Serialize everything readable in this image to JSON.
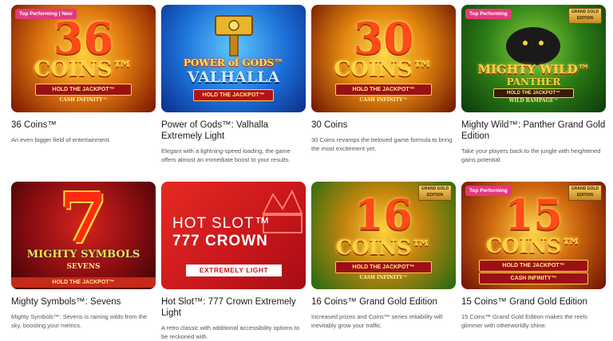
{
  "games": [
    {
      "title": "36 Coins™",
      "desc": "An even bigger field of entertainment.",
      "badge": "Top Performing | New",
      "art_main": "36",
      "art_sub": "COINS™",
      "art_plate": "HOLD THE JACKPOT™",
      "art_plate2": "CASH INFINITY™"
    },
    {
      "title": "Power of Gods™: Valhalla Extremely Light",
      "desc": "Elegant with a lightning-speed loading, the game offers almost an immediate boost to your results.",
      "art_main": "POWER of GODS™",
      "art_sub": "VALHALLA",
      "art_plate": "HOLD THE JACKPOT™"
    },
    {
      "title": "30 Coins",
      "desc": "30 Coins revamps the beloved game formula to bring the most excitement yet.",
      "art_main": "30",
      "art_sub": "COINS™",
      "art_plate": "HOLD THE JACKPOT™",
      "art_plate2": "CASH INFINITY™"
    },
    {
      "title": "Mighty Wild™: Panther Grand Gold Edition",
      "desc": "Take your players back to the jungle with heightened gains potential.",
      "badge": "Top Performing",
      "gold_label": "GRAND GOLD EDITION",
      "art_main": "MIGHTY WILD™",
      "art_sub": "PANTHER",
      "art_plate": "HOLD THE JACKPOT™",
      "art_plate2": "WILD RAMPAGE™"
    },
    {
      "title": "Mighty Symbols™: Sevens",
      "desc": "Mighty Symbols™: Sevens is raining wilds from the sky, boosting your metrics.",
      "art_main": "7",
      "art_sub": "MIGHTY SYMBOLS",
      "art_sub2": "SEVENS",
      "art_plate": "HOLD THE JACKPOT™"
    },
    {
      "title": "Hot Slot™: 777 Crown Extremely Light",
      "desc": "A retro classic with additional accessibility options to be reckoned with.",
      "art_main": "HOT SLOT™",
      "art_sub": "777 CROWN",
      "art_plate": "EXTREMELY LIGHT"
    },
    {
      "title": "16 Coins™ Grand Gold Edition",
      "desc": "Increased prizes and Coins™ series reliability will inevitably grow your traffic.",
      "gold_label": "GRAND GOLD EDITION",
      "art_main": "16",
      "art_sub": "COINS™",
      "art_plate": "HOLD THE JACKPOT™",
      "art_plate2": "CASH INFINITY™"
    },
    {
      "title": "15 Coins™ Grand Gold Edition",
      "desc": "15 Coins™ Grand Gold Edition makes the reels glimmer with otherworldly shine.",
      "badge": "Top Performing",
      "gold_label": "GRAND GOLD EDITION",
      "art_main": "15",
      "art_sub": "COINS™",
      "art_plate": "HOLD THE JACKPOT™",
      "art_plate2": "CASH INFINITY™"
    }
  ],
  "colors": {
    "badge": "#e4397c",
    "text": "#1b1b1b",
    "muted": "#555555"
  }
}
